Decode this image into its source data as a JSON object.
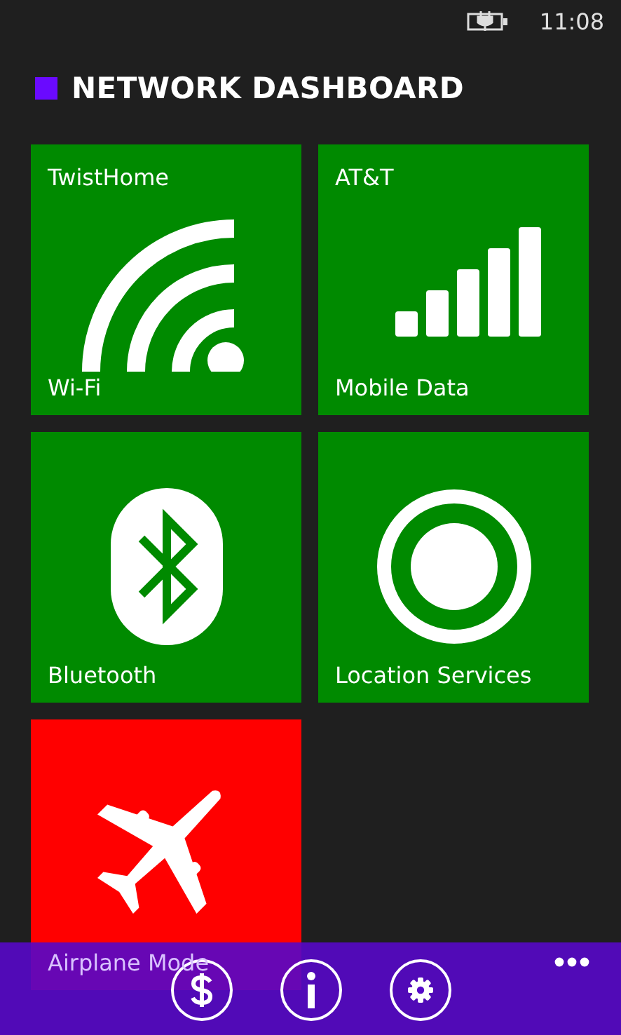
{
  "status_bar": {
    "time": "11:08"
  },
  "title": "NETWORK DASHBOARD",
  "tiles": [
    {
      "kind": "wifi",
      "top_label": "TwistHome",
      "label": "Wi-Fi",
      "on": true
    },
    {
      "kind": "cellular",
      "top_label": "AT&T",
      "label": "Mobile Data",
      "on": true
    },
    {
      "kind": "bluetooth",
      "label": "Bluetooth",
      "on": true
    },
    {
      "kind": "location",
      "label": "Location Services",
      "on": true
    },
    {
      "kind": "airplane",
      "label": "Airplane Mode",
      "on": false
    }
  ],
  "app_bar": {
    "buttons": [
      {
        "kind": "dollar"
      },
      {
        "kind": "info"
      },
      {
        "kind": "settings"
      }
    ]
  }
}
